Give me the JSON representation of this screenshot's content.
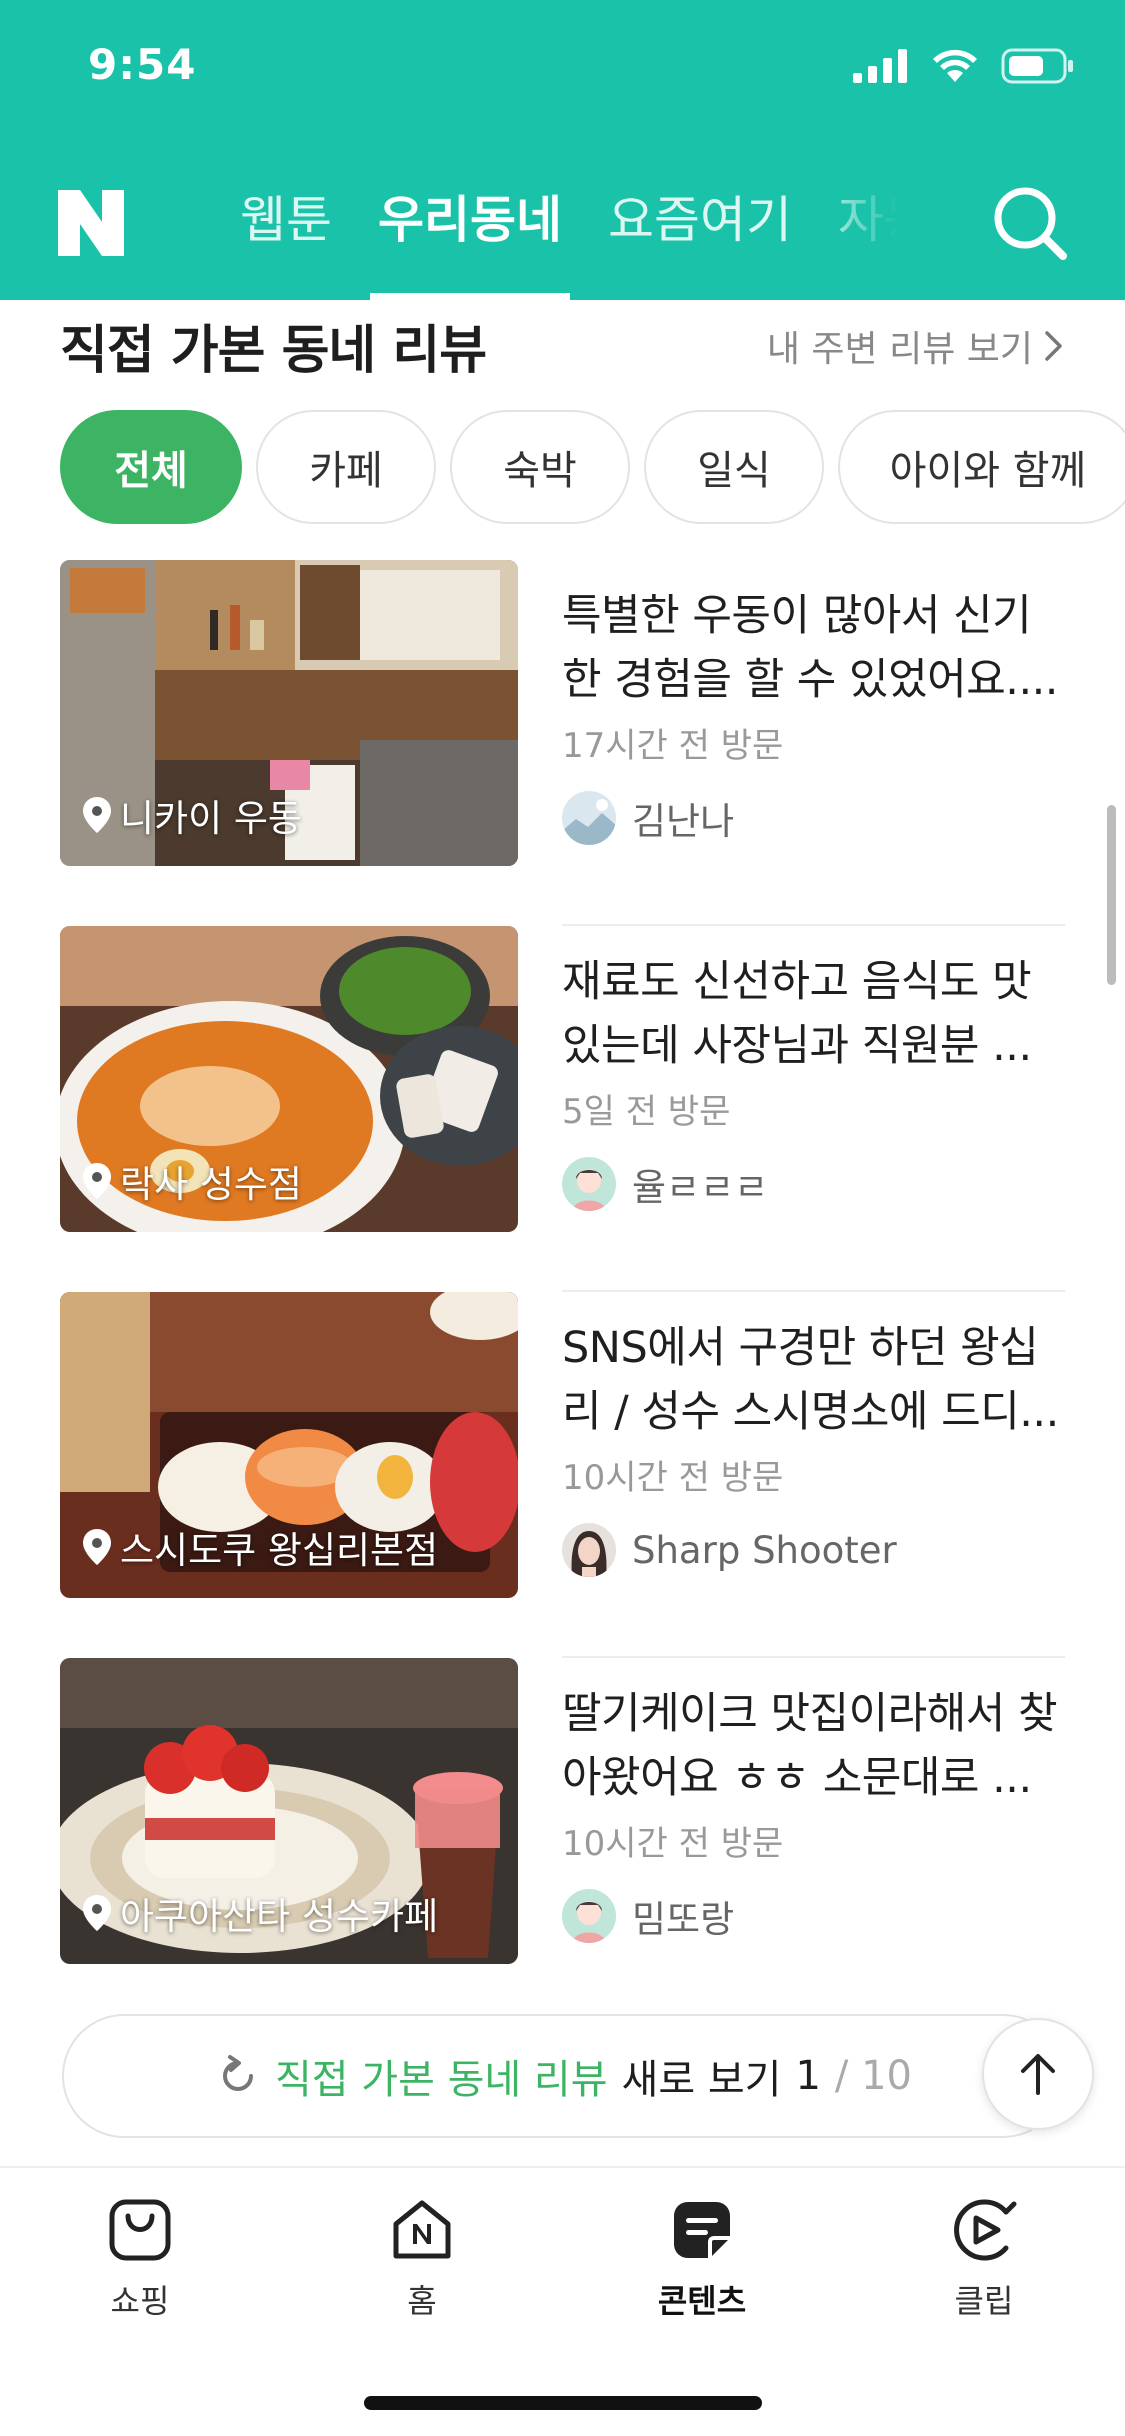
{
  "status_bar": {
    "time": "9:54"
  },
  "header": {
    "logo": "N",
    "tabs": [
      {
        "label": "웹툰",
        "active": false
      },
      {
        "label": "우리동네",
        "active": true
      },
      {
        "label": "요즘여기",
        "active": false
      },
      {
        "label": "자동",
        "active": false
      }
    ],
    "accent_color": "#19c2a8"
  },
  "section": {
    "title": "직접 가본 동네 리뷰",
    "link_label": "내 주변 리뷰 보기"
  },
  "chips": [
    {
      "label": "전체",
      "active": true
    },
    {
      "label": "카페",
      "active": false
    },
    {
      "label": "숙박",
      "active": false
    },
    {
      "label": "일식",
      "active": false
    },
    {
      "label": "아이와 함께",
      "active": false
    }
  ],
  "reviews": [
    {
      "place": "니카이 우동",
      "title": "특별한 우동이 많아서 신기한 경험을 할 수 있었어요....",
      "visit": "17시간 전 방문",
      "author": "김난나"
    },
    {
      "place": "락사 성수점",
      "title": "재료도 신선하고 음식도 맛있는데 사장님과 직원분 ...",
      "visit": "5일 전 방문",
      "author": "율ㄹㄹㄹ"
    },
    {
      "place": "스시도쿠 왕십리본점",
      "title": "SNS에서 구경만 하던 왕십리 / 성수 스시명소에 드디...",
      "visit": "10시간 전 방문",
      "author": "Sharp Shooter"
    },
    {
      "place": "아쿠아산타 성수카페",
      "title": "딸기케이크 맛집이라해서 찾아왔어요 ㅎㅎ 소문대로 ...",
      "visit": "10시간 전 방문",
      "author": "밈또랑"
    }
  ],
  "refresh": {
    "highlight": "직접 가본 동네 리뷰",
    "suffix": "새로 보기",
    "page": "1",
    "total": "/ 10"
  },
  "bottom_nav": [
    {
      "label": "쇼핑",
      "icon": "shopping-bag-icon",
      "active": false
    },
    {
      "label": "홈",
      "icon": "home-icon",
      "active": false
    },
    {
      "label": "콘텐츠",
      "icon": "contents-icon",
      "active": true
    },
    {
      "label": "클립",
      "icon": "clip-icon",
      "active": false
    }
  ],
  "colors": {
    "chip_active": "#3db464",
    "text_green": "#3db464"
  }
}
